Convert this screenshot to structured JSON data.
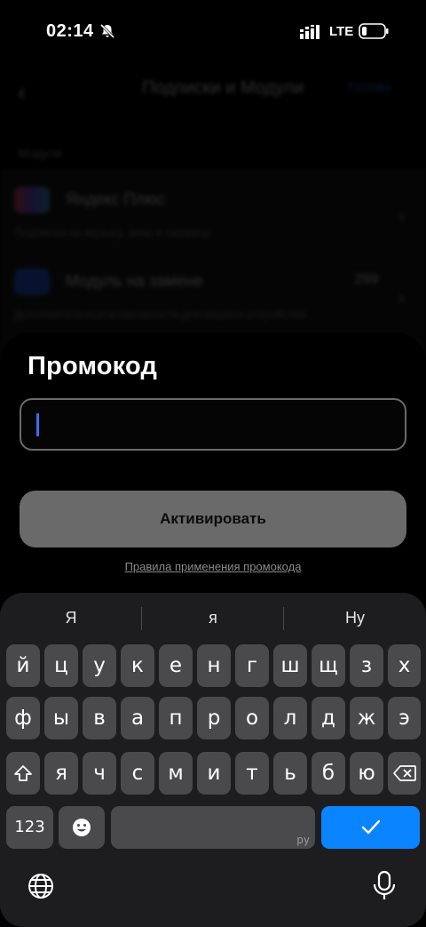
{
  "status_bar": {
    "time": "02:14",
    "network": "LTE",
    "icons": [
      "bell-off-icon",
      "signal-icon",
      "battery-icon"
    ]
  },
  "background_page": {
    "title": "Подписки и Модули",
    "action": "Готово",
    "section": "Модули",
    "rows": [
      {
        "title": "Яндекс Плюс",
        "desc": "Подписка на музыку, кино и сервисы"
      },
      {
        "title": "Модуль на замене",
        "price": "299",
        "desc": "Дополнительные возможности для вашего устройства"
      }
    ]
  },
  "sheet": {
    "title": "Промокод",
    "input_value": "",
    "input_placeholder": "",
    "activate_label": "Активировать",
    "rules_link": "Правила применения промокода"
  },
  "keyboard": {
    "suggestions": [
      "Я",
      "я",
      "Ну"
    ],
    "row1": [
      "й",
      "ц",
      "у",
      "к",
      "е",
      "н",
      "г",
      "ш",
      "щ",
      "з",
      "х"
    ],
    "row2": [
      "ф",
      "ы",
      "в",
      "а",
      "п",
      "р",
      "о",
      "л",
      "д",
      "ж",
      "э"
    ],
    "row3": [
      "я",
      "ч",
      "с",
      "м",
      "и",
      "т",
      "ь",
      "б",
      "ю"
    ],
    "numbers_label": "123",
    "space_hint": "ру",
    "colors": {
      "keyboard_bg": "#1d1d1f",
      "key_bg": "#4a4a4c",
      "enter_bg": "#0a84ff"
    }
  }
}
